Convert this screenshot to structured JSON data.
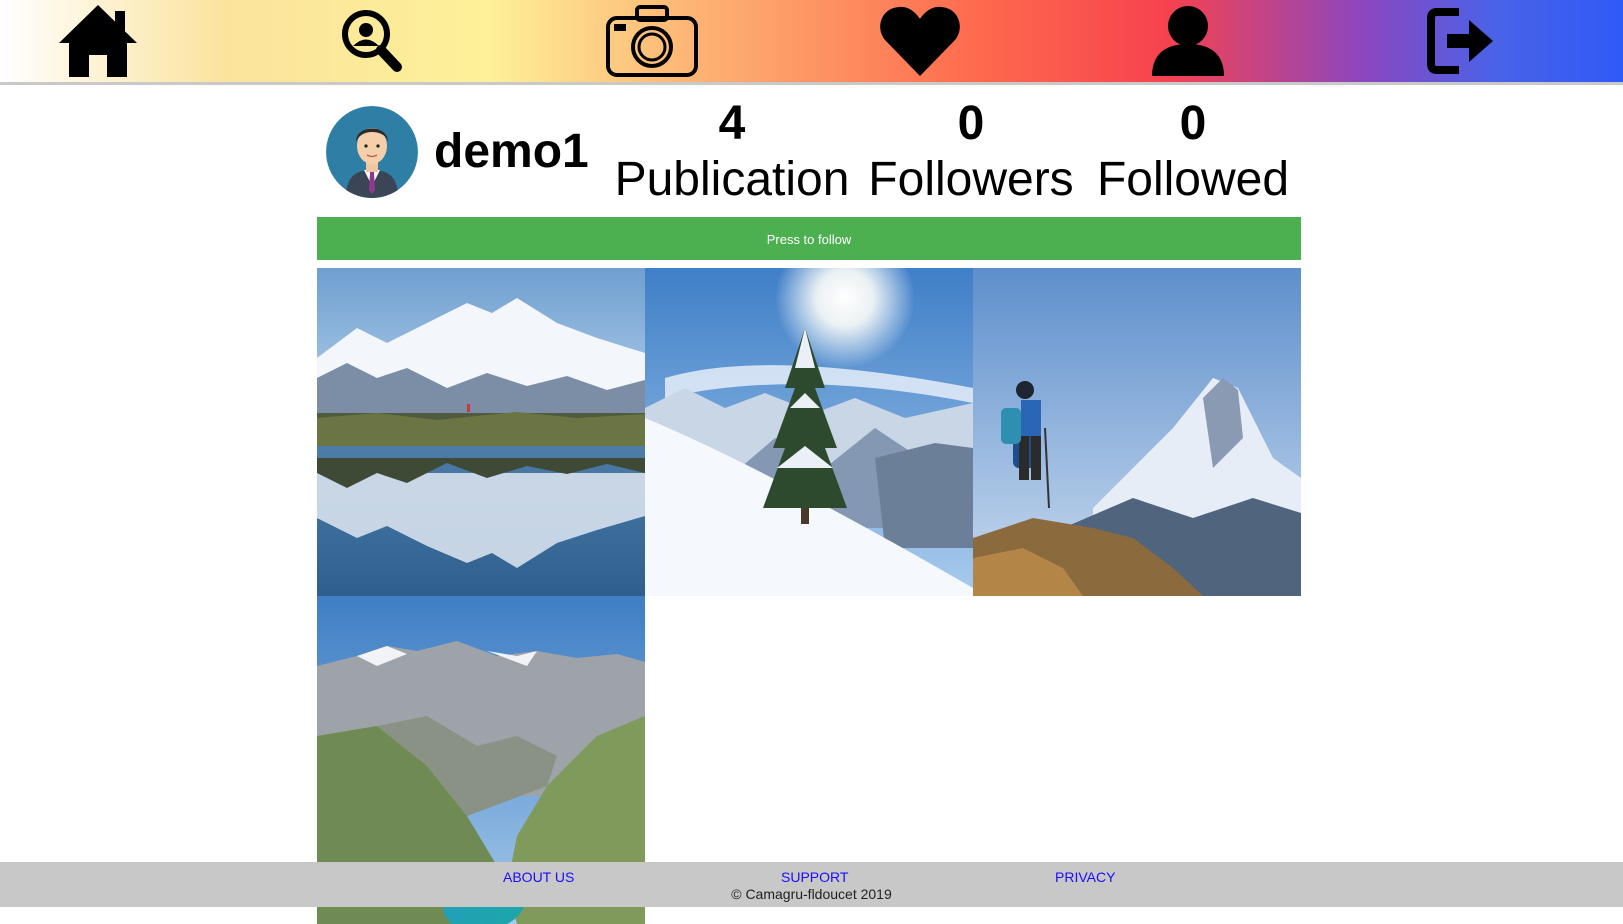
{
  "nav": {
    "items": [
      {
        "icon": "home-icon"
      },
      {
        "icon": "search-icon"
      },
      {
        "icon": "camera-icon"
      },
      {
        "icon": "heart-icon"
      },
      {
        "icon": "user-icon"
      },
      {
        "icon": "logout-icon"
      }
    ]
  },
  "profile": {
    "username": "demo1",
    "avatar_icon": "businessman-avatar",
    "stats": {
      "publications": {
        "value": "4",
        "label": "Publication"
      },
      "followers": {
        "value": "0",
        "label": "Followers"
      },
      "followed": {
        "value": "0",
        "label": "Followed"
      }
    },
    "follow_button": "Press to follow"
  },
  "gallery": {
    "images": [
      {
        "subject": "mountain-lake-reflection"
      },
      {
        "subject": "snowy-pine-tree-sun"
      },
      {
        "subject": "hiker-on-mountain-peak"
      },
      {
        "subject": "alpine-valley-turquoise-lake"
      }
    ]
  },
  "footer": {
    "about": "ABOUT US",
    "support": "SUPPORT",
    "privacy": "PRIVACY",
    "copyright": "© Camagru-fldoucet 2019"
  },
  "colors": {
    "follow_button": "#4caf50",
    "footer_bg": "#c8c8c8",
    "footer_link": "#1a0dff"
  }
}
